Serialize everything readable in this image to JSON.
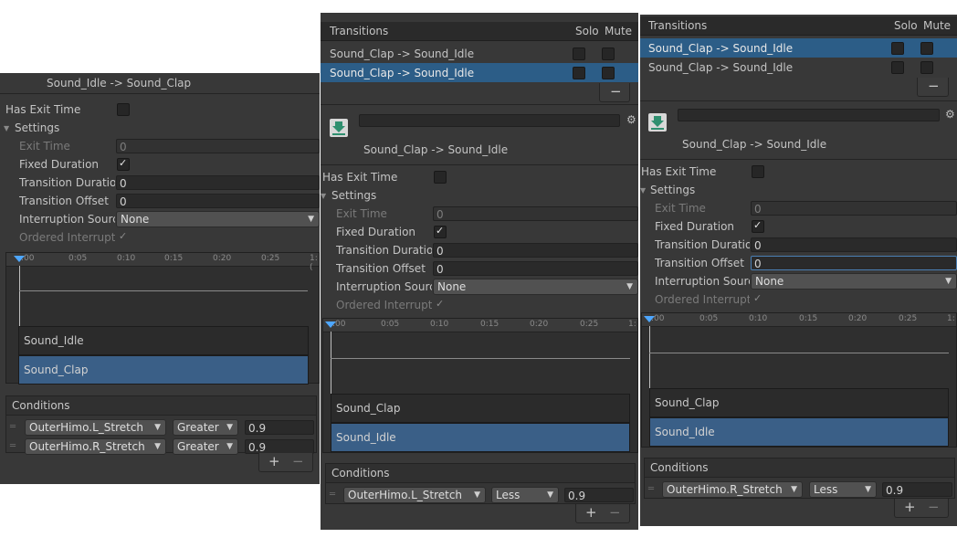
{
  "panel1": {
    "title": "Sound_Idle -> Sound_Clap",
    "has_exit_time_label": "Has Exit Time",
    "settings_label": "Settings",
    "exit_time_label": "Exit Time",
    "exit_time_value": "0",
    "fixed_duration_label": "Fixed Duration",
    "transition_duration_label": "Transition Duratior",
    "transition_duration_value": "0",
    "transition_offset_label": "Transition Offset",
    "transition_offset_value": "0",
    "interruption_source_label": "Interruption Source",
    "interruption_source_value": "None",
    "ordered_interruption_label": "Ordered Interruptio",
    "ruler": [
      ":00",
      "0:05",
      "0:10",
      "0:15",
      "0:20",
      "0:25",
      "1:("
    ],
    "bar_top": "Sound_Idle",
    "bar_bottom": "Sound_Clap",
    "conditions_label": "Conditions",
    "conditions": [
      {
        "param": "OuterHimo.L_Stretch",
        "mode": "Greater",
        "value": "0.9"
      },
      {
        "param": "OuterHimo.R_Stretch",
        "mode": "Greater",
        "value": "0.9"
      }
    ]
  },
  "panel2": {
    "transitions_label": "Transitions",
    "solo_label": "Solo",
    "mute_label": "Mute",
    "transitions": [
      "Sound_Clap -> Sound_Idle",
      "Sound_Clap -> Sound_Idle"
    ],
    "selected_index": 1,
    "title": "Sound_Clap -> Sound_Idle",
    "has_exit_time_label": "Has Exit Time",
    "settings_label": "Settings",
    "exit_time_label": "Exit Time",
    "exit_time_value": "0",
    "fixed_duration_label": "Fixed Duration",
    "transition_duration_label": "Transition Duratior",
    "transition_duration_value": "0",
    "transition_offset_label": "Transition Offset",
    "transition_offset_value": "0",
    "interruption_source_label": "Interruption Source",
    "interruption_source_value": "None",
    "ordered_interruption_label": "Ordered Interruptio",
    "ruler": [
      ":00",
      "0:05",
      "0:10",
      "0:15",
      "0:20",
      "0:25",
      "1:"
    ],
    "bar_top": "Sound_Clap",
    "bar_bottom": "Sound_Idle",
    "conditions_label": "Conditions",
    "conditions": [
      {
        "param": "OuterHimo.L_Stretch",
        "mode": "Less",
        "value": "0.9"
      }
    ]
  },
  "panel3": {
    "transitions_label": "Transitions",
    "solo_label": "Solo",
    "mute_label": "Mute",
    "transitions": [
      "Sound_Clap -> Sound_Idle",
      "Sound_Clap -> Sound_Idle"
    ],
    "selected_index": 0,
    "title": "Sound_Clap -> Sound_Idle",
    "has_exit_time_label": "Has Exit Time",
    "settings_label": "Settings",
    "exit_time_label": "Exit Time",
    "exit_time_value": "0",
    "fixed_duration_label": "Fixed Duration",
    "transition_duration_label": "Transition Duratior",
    "transition_duration_value": "0",
    "transition_offset_label": "Transition Offset",
    "transition_offset_value": "0",
    "interruption_source_label": "Interruption Source",
    "interruption_source_value": "None",
    "ordered_interruption_label": "Ordered Interruptio",
    "ruler": [
      ":00",
      "0:05",
      "0:10",
      "0:15",
      "0:20",
      "0:25",
      "1:"
    ],
    "bar_top": "Sound_Clap",
    "bar_bottom": "Sound_Idle",
    "conditions_label": "Conditions",
    "conditions": [
      {
        "param": "OuterHimo.R_Stretch",
        "mode": "Less",
        "value": "0.9"
      }
    ]
  },
  "common": {
    "plus": "+",
    "minus": "−",
    "caret": "▼",
    "expand_arrow": "▼",
    "grip": "═"
  }
}
